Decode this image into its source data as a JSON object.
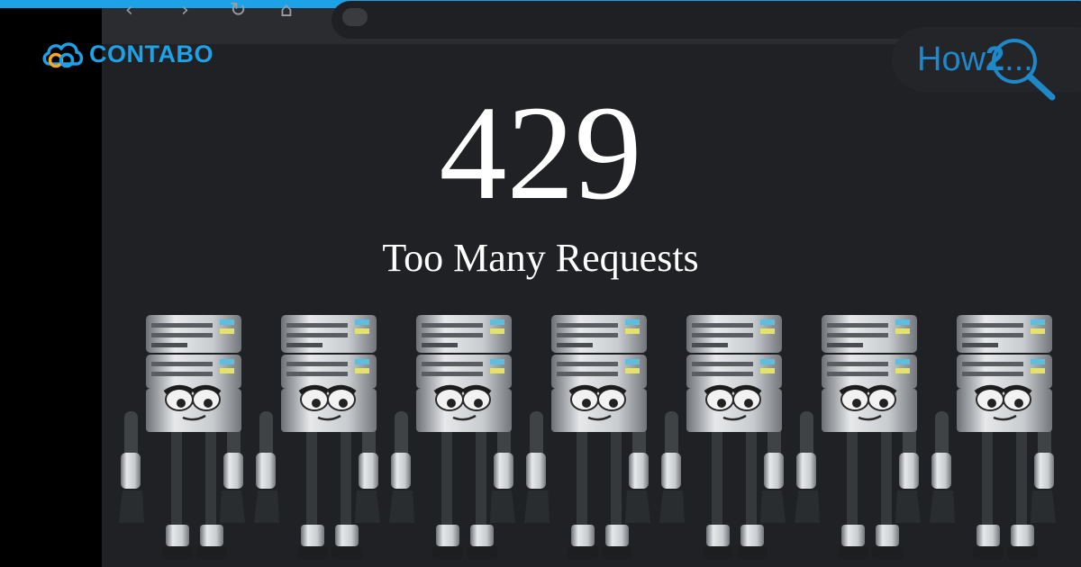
{
  "branding": {
    "contabo_text": "CONTABO",
    "how2_prefix": "How",
    "how2_number": "2",
    "how2_suffix": "...",
    "accent_color": "#1da1e7",
    "logo_orange": "#f7a823"
  },
  "browser": {
    "icons": [
      "back-arrow-icon",
      "forward-arrow-icon",
      "reload-icon",
      "home-icon",
      "site-info-icon"
    ]
  },
  "error": {
    "code": "429",
    "message": "Too Many Requests"
  },
  "illustration": {
    "figure": "server-robot",
    "count": 7
  }
}
